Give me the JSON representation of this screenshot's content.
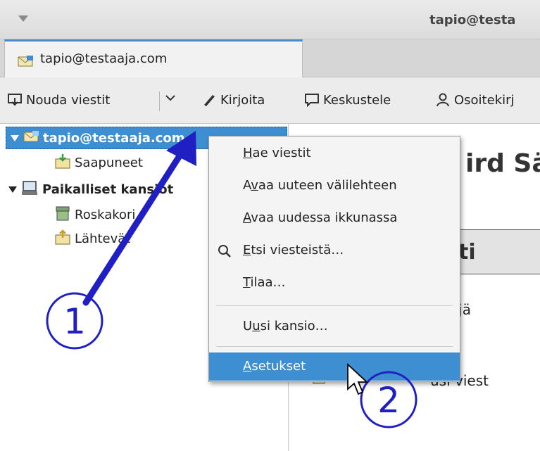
{
  "window": {
    "title": "tapio@testa"
  },
  "tab": {
    "label": "tapio@testaaja.com"
  },
  "toolbar": {
    "get_messages": "Nouda viestit",
    "write": "Kirjoita",
    "chat": "Keskustele",
    "address_book": "Osoitekirj"
  },
  "folders": {
    "account": "tapio@testaaja.com",
    "inbox": "Saapuneet",
    "local": "Paikalliset kansiot",
    "trash": "Roskakori",
    "outbox": "Lähtevät"
  },
  "main": {
    "heading": "ird Sä",
    "box_text": "ti",
    "line1": "tejä",
    "line2": "usi viest"
  },
  "context_menu": {
    "items": [
      {
        "pre": "",
        "key": "H",
        "post": "ae viestit"
      },
      {
        "pre": "A",
        "key": "v",
        "post": "aa uuteen välilehteen"
      },
      {
        "pre": "",
        "key": "A",
        "post": "vaa uudessa ikkunassa"
      },
      {
        "pre": "",
        "key": "E",
        "post": "tsi viesteistä…"
      },
      {
        "pre": "",
        "key": "T",
        "post": "ilaa…"
      },
      {
        "pre": "U",
        "key": "u",
        "post": "si kansio…"
      },
      {
        "pre": "",
        "key": "A",
        "post": "setukset"
      }
    ]
  },
  "annotations": {
    "step1": "1",
    "step2": "2",
    "color": "#1f1fc4"
  },
  "colors": {
    "accent": "#3d8fd1"
  }
}
